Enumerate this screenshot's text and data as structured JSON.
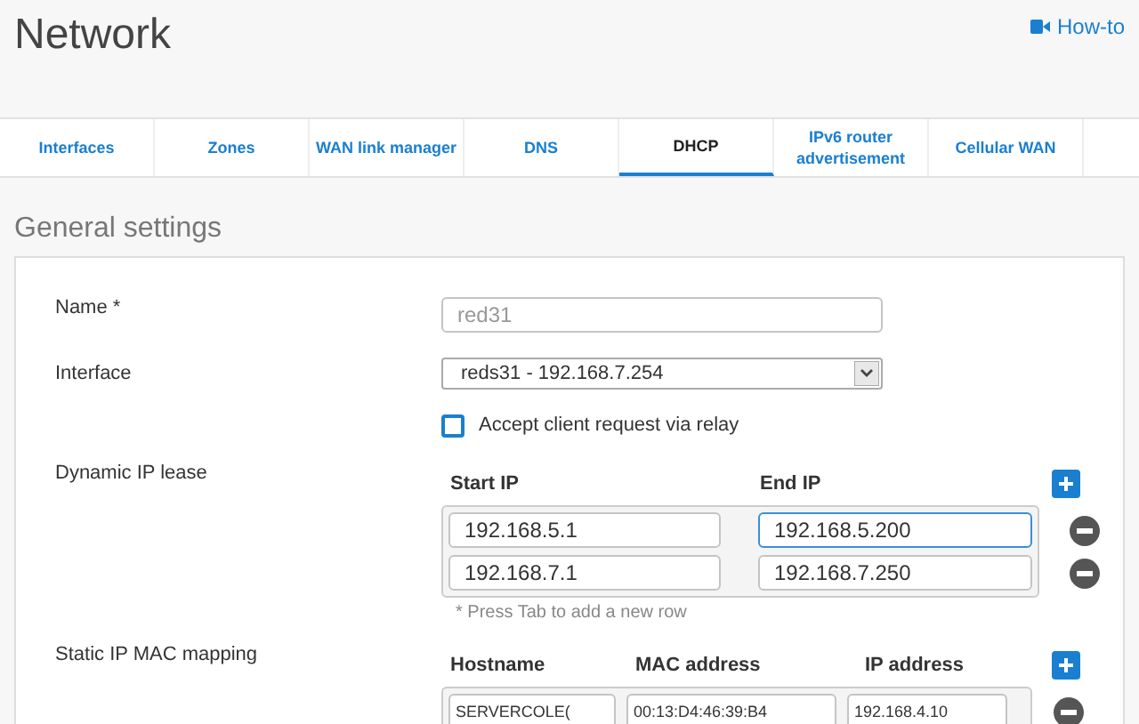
{
  "page": {
    "title": "Network",
    "help_link": "How-to"
  },
  "tabs": [
    {
      "label": "Interfaces",
      "selected": false
    },
    {
      "label": "Zones",
      "selected": false
    },
    {
      "label": "WAN link manager",
      "selected": false
    },
    {
      "label": "DNS",
      "selected": false
    },
    {
      "label": "DHCP",
      "selected": true
    },
    {
      "label": "IPv6 router advertisement",
      "selected": false
    },
    {
      "label": "Cellular WAN",
      "selected": false
    }
  ],
  "section": {
    "title": "General settings"
  },
  "name": {
    "label": "Name *",
    "value": "red31",
    "disabled": true
  },
  "interface": {
    "label": "Interface",
    "value": "reds31 - 192.168.7.254"
  },
  "relay": {
    "label": "Accept client request via relay",
    "checked": false
  },
  "dynamic_lease": {
    "label": "Dynamic IP lease",
    "columns": [
      "Start IP",
      "End IP"
    ],
    "rows": [
      {
        "start": "192.168.5.1",
        "end": "192.168.5.200",
        "focused": true
      },
      {
        "start": "192.168.7.1",
        "end": "192.168.7.250",
        "focused": false
      }
    ],
    "hint": "* Press Tab to add a new row"
  },
  "static_mapping": {
    "label": "Static IP MAC mapping",
    "columns": [
      "Hostname",
      "MAC address",
      "IP address"
    ],
    "rows": [
      {
        "hostname": "SERVERCOLE(",
        "mac": "00:13:D4:46:39:B4",
        "ip": "192.168.4.10"
      }
    ]
  }
}
